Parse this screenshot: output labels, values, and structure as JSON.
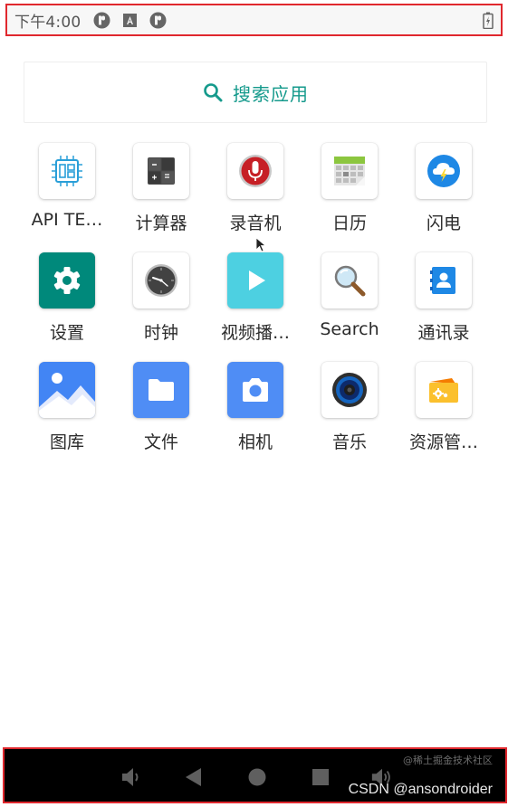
{
  "status_bar": {
    "time": "下午4:00",
    "icons": [
      "notification-p-icon",
      "notification-a-icon",
      "notification-p-icon",
      "battery-charging-icon"
    ]
  },
  "search": {
    "label": "搜索应用",
    "icon": "search-icon",
    "color": "#159a8c"
  },
  "apps": [
    {
      "label": "API TE…",
      "icon": "chip-icon"
    },
    {
      "label": "计算器",
      "icon": "calculator-icon"
    },
    {
      "label": "录音机",
      "icon": "microphone-icon"
    },
    {
      "label": "日历",
      "icon": "calendar-icon"
    },
    {
      "label": "闪电",
      "icon": "cloud-lightning-icon"
    },
    {
      "label": "设置",
      "icon": "gear-icon"
    },
    {
      "label": "时钟",
      "icon": "clock-icon"
    },
    {
      "label": "视频播…",
      "icon": "play-icon"
    },
    {
      "label": "Search",
      "icon": "magnifier-icon"
    },
    {
      "label": "通讯录",
      "icon": "contacts-icon"
    },
    {
      "label": "图库",
      "icon": "gallery-icon"
    },
    {
      "label": "文件",
      "icon": "folder-icon"
    },
    {
      "label": "相机",
      "icon": "camera-icon"
    },
    {
      "label": "音乐",
      "icon": "speaker-icon"
    },
    {
      "label": "资源管…",
      "icon": "file-manager-icon"
    }
  ],
  "nav_bar": {
    "items": [
      "volume-down-icon",
      "back-icon",
      "home-icon",
      "recents-icon",
      "volume-up-icon"
    ],
    "watermark": "CSDN @ansondroider",
    "watermark_small": "@稀土掘金技术社区"
  },
  "colors": {
    "highlight_border": "#e0282e",
    "accent": "#159a8c"
  }
}
